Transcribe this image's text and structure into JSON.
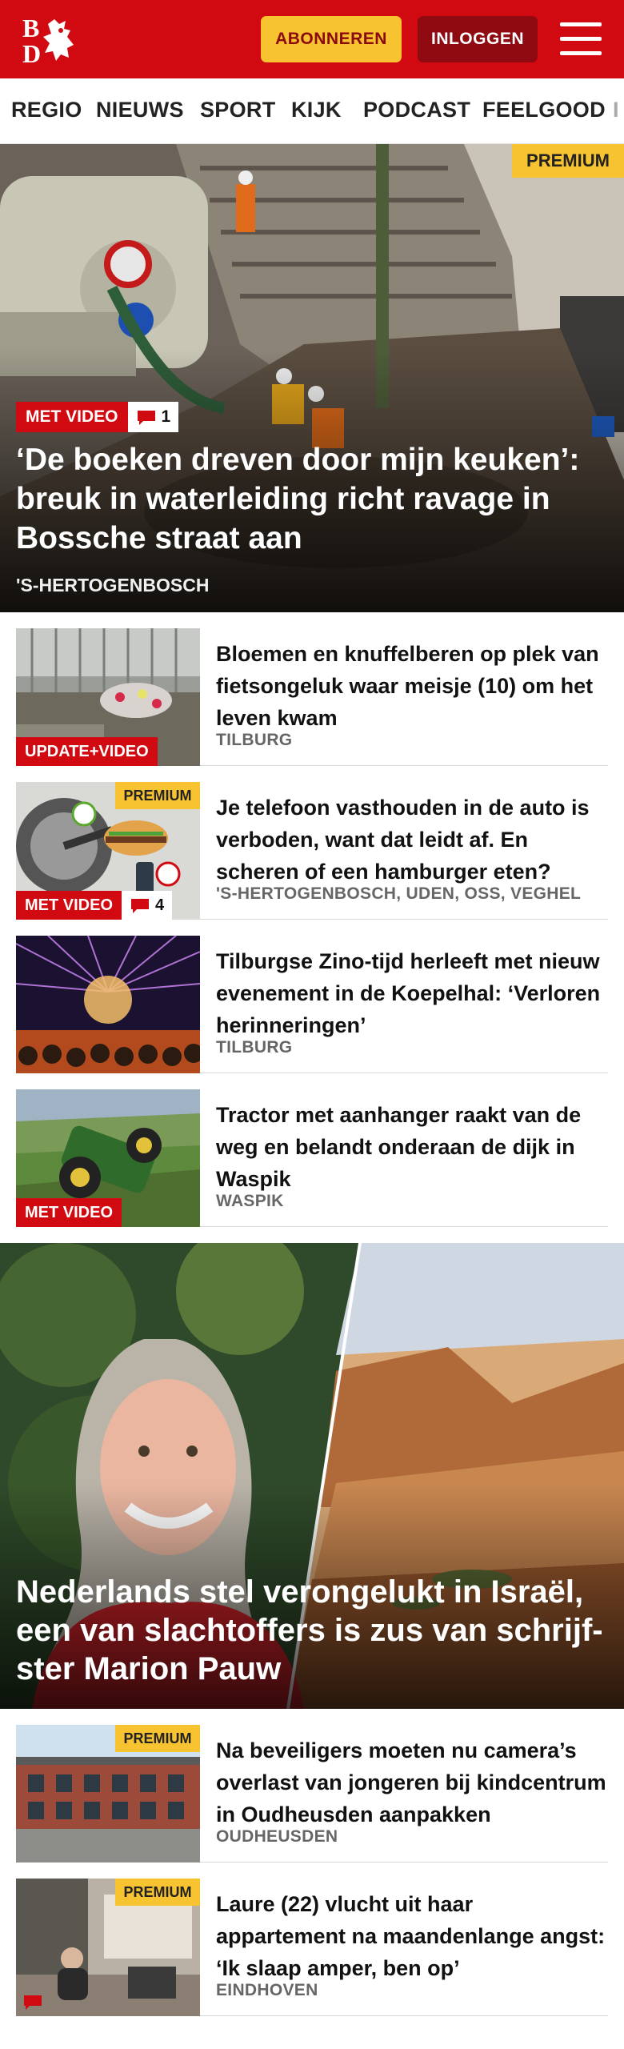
{
  "header": {
    "logo_text": "BD",
    "subscribe_label": "ABONNEREN",
    "login_label": "INLOGGEN",
    "colors": {
      "brand_red": "#d10a11",
      "dark_red": "#8e0a10",
      "yellow": "#f7c331"
    }
  },
  "nav": {
    "items": [
      "REGIO",
      "NIEUWS",
      "SPORT",
      "KIJK",
      "PODCAST",
      "FEELGOOD",
      "I"
    ]
  },
  "hero": {
    "premium_label": "PREMIUM",
    "badge_label": "MET VIDEO",
    "comment_count": "1",
    "title": "‘De boeken dreven door mijn keuken’: breuk in waterleiding richt ravage in Bossche straat aan",
    "location": "'S-HERTOGENBOSCH"
  },
  "articles": [
    {
      "title": "Bloemen en knuffelberen op plek van fietsongeluk waar meisje (10) om het leven kwam",
      "location": "TILBURG",
      "badge_label": "UPDATE+VIDEO",
      "comment_count": "",
      "premium_label": ""
    },
    {
      "title": "Je telefoon vasthouden in de auto is verboden, want dat leidt af. En scheren of een hamburger eten?",
      "location": "'S-HERTOGENBOSCH, UDEN, OSS, VEGHEL",
      "badge_label": "MET VIDEO",
      "comment_count": "4",
      "premium_label": "PREMIUM"
    },
    {
      "title": "Tilburgse Zino-tijd herleeft met nieuw evenement in de Koepelhal: ‘Verloren herinneringen’",
      "location": "TILBURG",
      "badge_label": "",
      "comment_count": "",
      "premium_label": ""
    },
    {
      "title": "Tractor met aanhanger raakt van de weg en belandt onderaan de dijk in Waspik",
      "location": "WASPIK",
      "badge_label": "MET VIDEO",
      "comment_count": "",
      "premium_label": ""
    }
  ],
  "feature": {
    "title": "Nederlands stel verongelukt in Israël, een van slachtoffers is zus van schrijf-ster Marion Pauw"
  },
  "articles2": [
    {
      "title": "Na beveiligers moeten nu camera’s overlast van jongeren bij kindcentrum in Oudheusden aanpakken",
      "location": "OUDHEUSDEN",
      "premium_label": "PREMIUM"
    },
    {
      "title": "Laure (22) vlucht uit haar appartement na maandenlange angst: ‘Ik slaap amper, ben op’",
      "location": "EINDHOVEN",
      "premium_label": "PREMIUM"
    }
  ]
}
